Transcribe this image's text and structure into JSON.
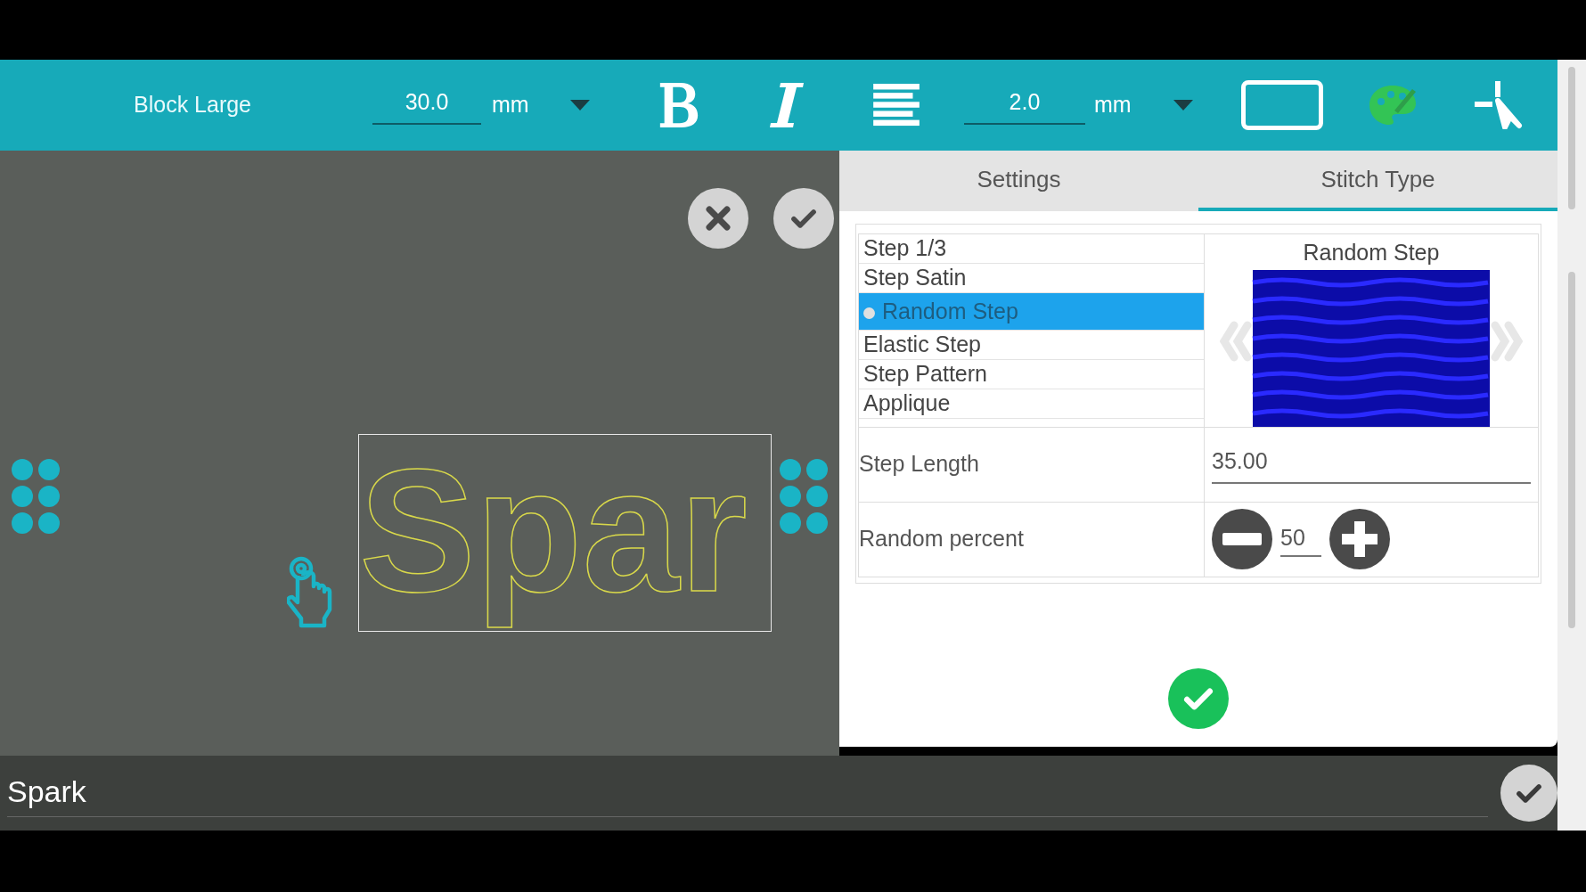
{
  "toolbar": {
    "font_name": "Block Large",
    "size": {
      "value": "30.0",
      "unit": "mm"
    },
    "spacing": {
      "value": "2.0",
      "unit": "mm"
    }
  },
  "canvas": {
    "design_text": "Spar"
  },
  "panel": {
    "tabs": [
      {
        "label": "Settings",
        "selected": false
      },
      {
        "label": "Stitch Type",
        "selected": true
      }
    ],
    "stitch_list": [
      {
        "label": "Step 1/3",
        "selected": false
      },
      {
        "label": "Step Satin",
        "selected": false
      },
      {
        "label": "Random Step",
        "selected": true
      },
      {
        "label": "Elastic Step",
        "selected": false
      },
      {
        "label": "Step Pattern",
        "selected": false
      },
      {
        "label": "Applique",
        "selected": false
      }
    ],
    "preview_title": "Random Step",
    "params": [
      {
        "kind": "field",
        "label": "Step Length",
        "value": "35.00"
      },
      {
        "kind": "stepper",
        "label": "Random percent",
        "value": "50"
      }
    ]
  },
  "text_input": {
    "value": "Spark"
  }
}
